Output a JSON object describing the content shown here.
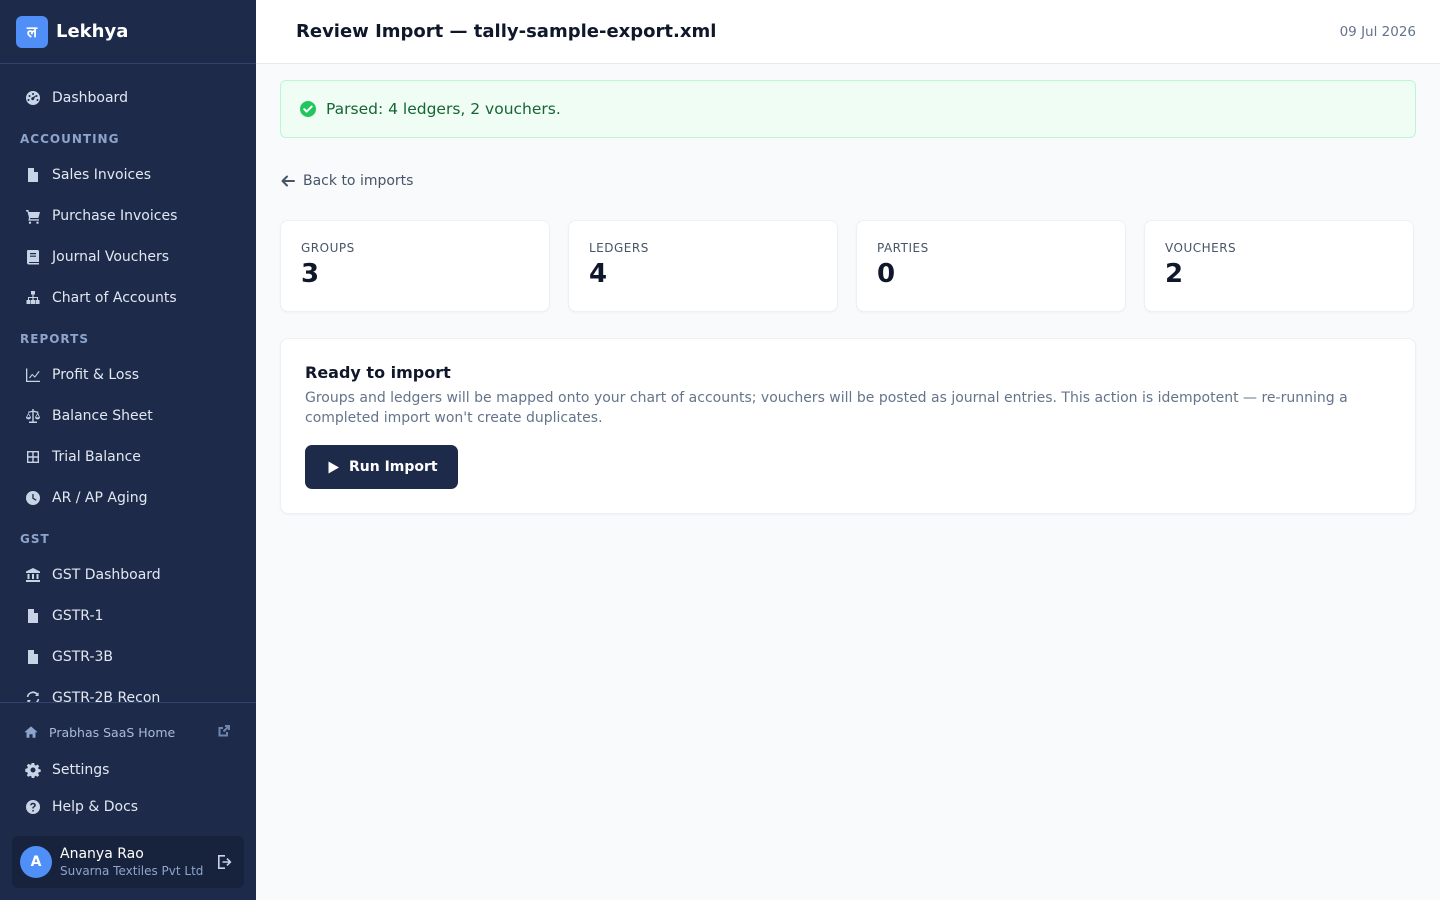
{
  "brand": {
    "logo_glyph": "ल",
    "name": "Lekhya",
    "accent": "#4f8ff7"
  },
  "sidebar": {
    "dashboard": {
      "label": "Dashboard",
      "icon": "dashboard-icon"
    },
    "sections": {
      "accounting": "ACCOUNTING",
      "reports": "REPORTS",
      "gst": "GST"
    },
    "accounting_items": [
      {
        "label": "Sales Invoices",
        "icon": "file-icon"
      },
      {
        "label": "Purchase Invoices",
        "icon": "cart-icon"
      },
      {
        "label": "Journal Vouchers",
        "icon": "book-icon"
      },
      {
        "label": "Chart of Accounts",
        "icon": "sitemap-icon"
      }
    ],
    "report_items": [
      {
        "label": "Profit & Loss",
        "icon": "line-chart-icon"
      },
      {
        "label": "Balance Sheet",
        "icon": "scale-icon"
      },
      {
        "label": "Trial Balance",
        "icon": "table-icon"
      },
      {
        "label": "AR / AP Aging",
        "icon": "clock-icon"
      }
    ],
    "gst_items": [
      {
        "label": "GST Dashboard",
        "icon": "bank-icon"
      },
      {
        "label": "GSTR-1",
        "icon": "file-icon"
      },
      {
        "label": "GSTR-3B",
        "icon": "file-icon"
      },
      {
        "label": "GSTR-2B Recon",
        "icon": "sync-icon"
      }
    ],
    "bottom": {
      "saas_home": "Prabhas SaaS Home",
      "settings": "Settings",
      "help": "Help & Docs"
    },
    "user": {
      "initial": "A",
      "name": "Ananya Rao",
      "org": "Suvarna Textiles Pvt Ltd"
    }
  },
  "header": {
    "title": "Review Import — tally-sample-export.xml",
    "date": "09 Jul 2026"
  },
  "alert": {
    "text": "Parsed: 4 ledgers, 2 vouchers.",
    "color": "#22c55e"
  },
  "back_link": "Back to imports",
  "stats": [
    {
      "label": "GROUPS",
      "value": "3"
    },
    {
      "label": "LEDGERS",
      "value": "4"
    },
    {
      "label": "PARTIES",
      "value": "0"
    },
    {
      "label": "VOUCHERS",
      "value": "2"
    }
  ],
  "ready": {
    "title": "Ready to import",
    "description": "Groups and ledgers will be mapped onto your chart of accounts; vouchers will be posted as journal entries. This action is idempotent — re-running a completed import won't create duplicates.",
    "button": "Run Import"
  }
}
